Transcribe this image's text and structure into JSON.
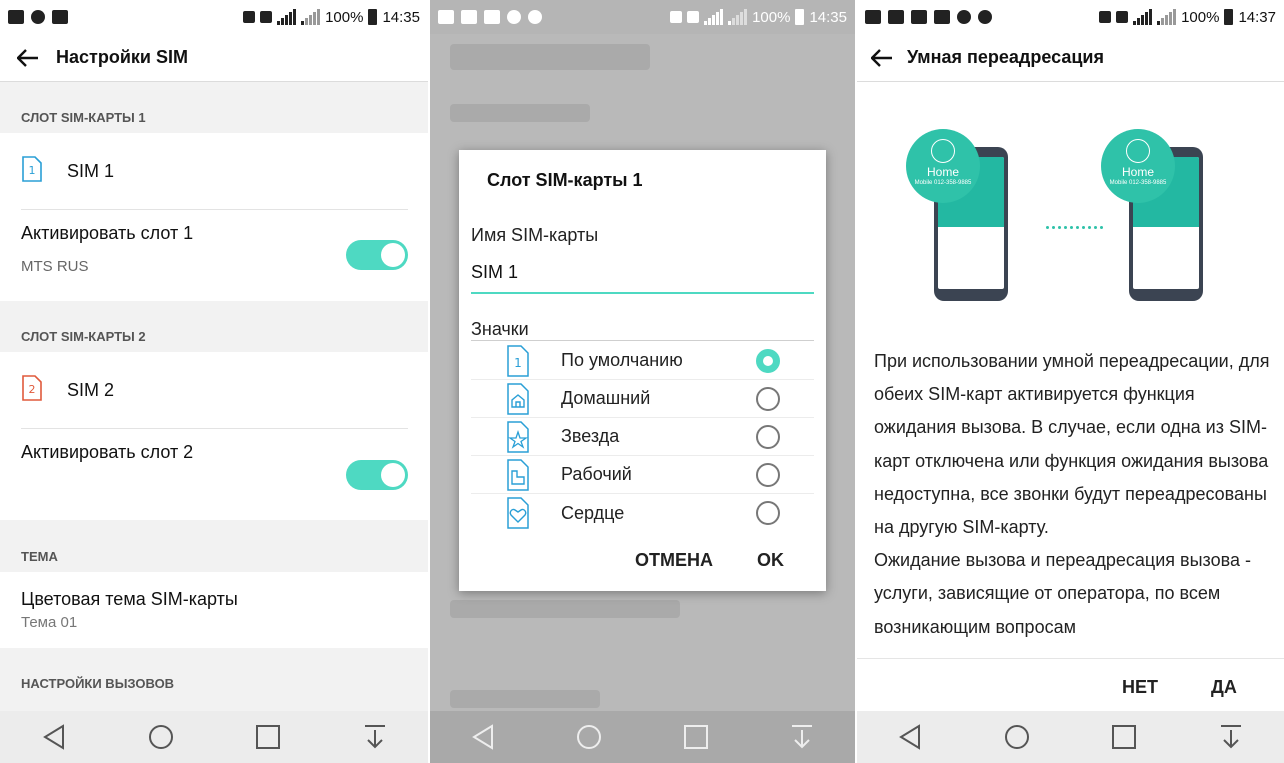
{
  "statusbar": {
    "screen1": {
      "battery": "100%",
      "time": "14:35"
    },
    "screen2": {
      "battery": "100%",
      "time": "14:35"
    },
    "screen3": {
      "battery": "100%",
      "time": "14:37"
    }
  },
  "screen1": {
    "title": "Настройки SIM",
    "slot1_header": "СЛОТ SIM-КАРТЫ 1",
    "sim1_label": "SIM 1",
    "sim1_icon_number": "1",
    "activate1": "Активировать слот 1",
    "operator1": "MTS RUS",
    "activate1_on": true,
    "slot2_header": "СЛОТ SIM-КАРТЫ 2",
    "sim2_label": "SIM 2",
    "sim2_icon_number": "2",
    "activate2": "Активировать слот 2",
    "activate2_on": true,
    "theme_header": "ТЕМА",
    "theme_title": "Цветовая тема SIM-карты",
    "theme_value": "Тема 01",
    "calls_header": "НАСТРОЙКИ ВЫЗОВОВ"
  },
  "screen2": {
    "dialog_title": "Слот SIM-карты 1",
    "name_label": "Имя SIM-карты",
    "name_value": "SIM 1",
    "icons_label": "Значки",
    "icon_options": [
      {
        "label": "По умолчанию",
        "icon": "sim-number-icon",
        "selected": true
      },
      {
        "label": "Домашний",
        "icon": "sim-home-icon",
        "selected": false
      },
      {
        "label": "Звезда",
        "icon": "sim-star-icon",
        "selected": false
      },
      {
        "label": "Рабочий",
        "icon": "sim-work-icon",
        "selected": false
      },
      {
        "label": "Сердце",
        "icon": "sim-heart-icon",
        "selected": false
      }
    ],
    "cancel": "ОТМЕНА",
    "ok": "OK"
  },
  "screen3": {
    "title": "Умная переадресация",
    "bubble_title": "Home",
    "bubble_sub": "Mobile 012-358-9885",
    "body_p1": "При использовании умной переадресации, для обеих SIM-карт активируется функция ожидания вызова. В случае, если одна из SIM-карт отключена или функция ожидания вызова недоступна, все звонки будут переадресованы на другую SIM-карту.",
    "body_p2": "Ожидание вызова и переадресация вызова - услуги, зависящие от оператора, по всем возникающим вопросам",
    "no": "НЕТ",
    "yes": "ДА"
  },
  "colors": {
    "accent": "#4ed9c2",
    "sim1_icon": "#2a9fd6",
    "sim2_icon": "#e05a3c"
  }
}
